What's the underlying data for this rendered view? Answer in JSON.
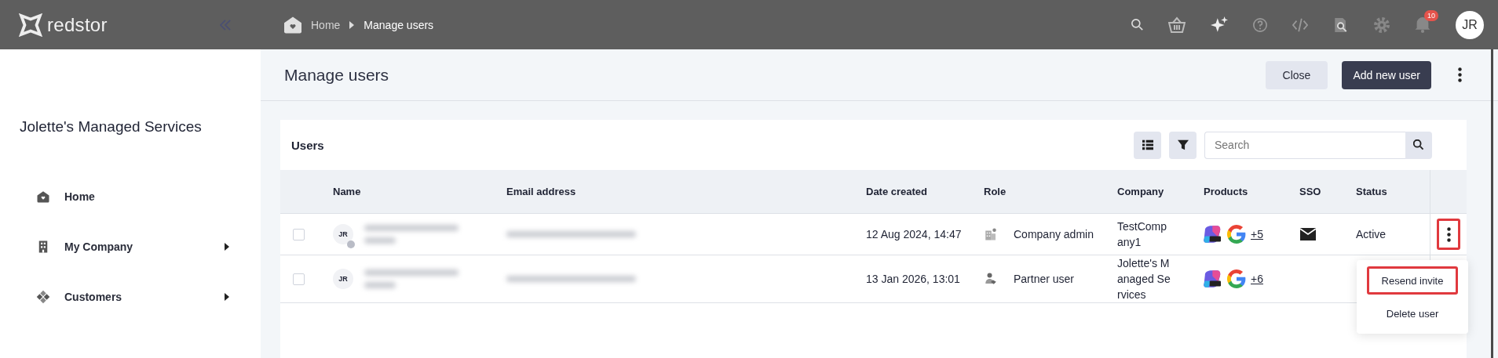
{
  "app": {
    "logo": "redstor"
  },
  "breadcrumb": [
    {
      "label": "Home",
      "kind": "home"
    },
    {
      "label": "Manage users",
      "kind": "current"
    }
  ],
  "topbar": {
    "notifications_badge": "10",
    "avatar": "JR"
  },
  "sidebar": {
    "title": "Jolette's Managed Services",
    "items": [
      {
        "label": "Home",
        "has_submenu": false
      },
      {
        "label": "My Company",
        "has_submenu": true
      },
      {
        "label": "Customers",
        "has_submenu": true
      }
    ]
  },
  "page": {
    "title": "Manage users",
    "buttons": [
      {
        "label": "Close",
        "kind": "secondary"
      },
      {
        "label": "Add new user",
        "kind": "primary"
      }
    ]
  },
  "users_card": {
    "title": "Users",
    "search": {
      "placeholder": "Search"
    },
    "table": {
      "columns": [
        "Name",
        "Email address",
        "Date created",
        "Role",
        "Company",
        "Products",
        "SSO",
        "Status"
      ],
      "rows": [
        {
          "checked": false,
          "avatar": "JR",
          "verified": true,
          "date_created": "12 Aug 2024, 14:47",
          "role": {
            "kind": "admin",
            "label": "Company admin"
          },
          "company": "TestCompany1",
          "more_products": "+5",
          "sso": true,
          "status": "Active"
        },
        {
          "checked": false,
          "avatar": "JR",
          "verified": false,
          "date_created": "13 Jan 2026, 13:01",
          "role": {
            "kind": "partner",
            "label": "Partner user"
          },
          "company": "Jolette's Managed Services",
          "more_products": "+6",
          "sso": false
        }
      ]
    }
  },
  "row_menu": {
    "button_highlighted": true,
    "items": [
      {
        "label": "Resend invite",
        "highlighted": true
      },
      {
        "label": "Delete user",
        "highlighted": false
      }
    ]
  }
}
